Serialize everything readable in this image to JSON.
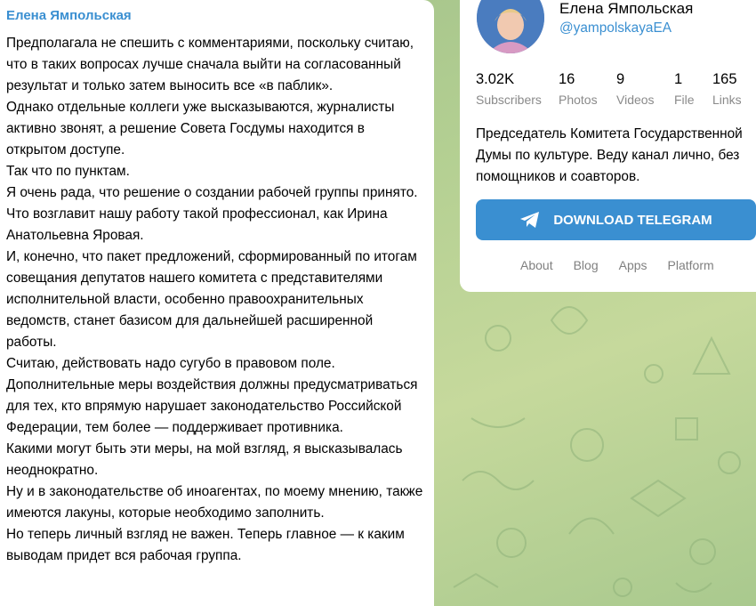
{
  "post": {
    "author": "Елена Ямпольская",
    "paragraphs": [
      "Предполагала не спешить с комментариями, поскольку считаю, что в таких вопросах лучше сначала выйти на согласованный результат и только затем выносить все «в паблик».",
      "Однако отдельные коллеги уже высказываются, журналисты активно звонят, а решение Совета Госдумы находится в открытом доступе.",
      "Так что по пунктам.",
      "Я очень рада, что решение о создании рабочей группы принято. Что возглавит нашу работу такой профессионал, как Ирина Анатольевна Яровая.",
      "И, конечно, что пакет предложений, сформированный по итогам совещания депутатов нашего комитета с представителями исполнительной власти, особенно правоохранительных ведомств, станет базисом для дальнейшей расширенной работы.",
      "Считаю, действовать надо сугубо в правовом поле. Дополнительные меры воздействия должны предусматриваться для тех, кто впрямую нарушает законодательство Российской Федерации, тем более — поддерживает противника.",
      "Какими могут быть эти меры, на мой взгляд, я высказывалась неоднократно.",
      "Ну и в законодательстве об иноагентах, по моему мнению, также имеются лакуны, которые необходимо заполнить.",
      "Но теперь личный взгляд не важен. Теперь главное — к каким выводам придет вся рабочая группа."
    ]
  },
  "channel": {
    "name": "Елена Ямпольская",
    "handle": "@yampolskayaEA",
    "stats": [
      {
        "value": "3.02K",
        "label": "Subscribers"
      },
      {
        "value": "16",
        "label": "Photos"
      },
      {
        "value": "9",
        "label": "Videos"
      },
      {
        "value": "1",
        "label": "File"
      },
      {
        "value": "165",
        "label": "Links"
      }
    ],
    "description": "Председатель Комитета Государственной Думы по культуре. Веду канал лично, без помощников и соавторов.",
    "download_label": "DOWNLOAD TELEGRAM",
    "links": [
      "About",
      "Blog",
      "Apps",
      "Platform"
    ]
  },
  "colors": {
    "accent": "#3a8fd1",
    "background": "#b3cf92"
  },
  "icons": {
    "download": "telegram-plane-icon",
    "avatar": "channel-avatar"
  }
}
